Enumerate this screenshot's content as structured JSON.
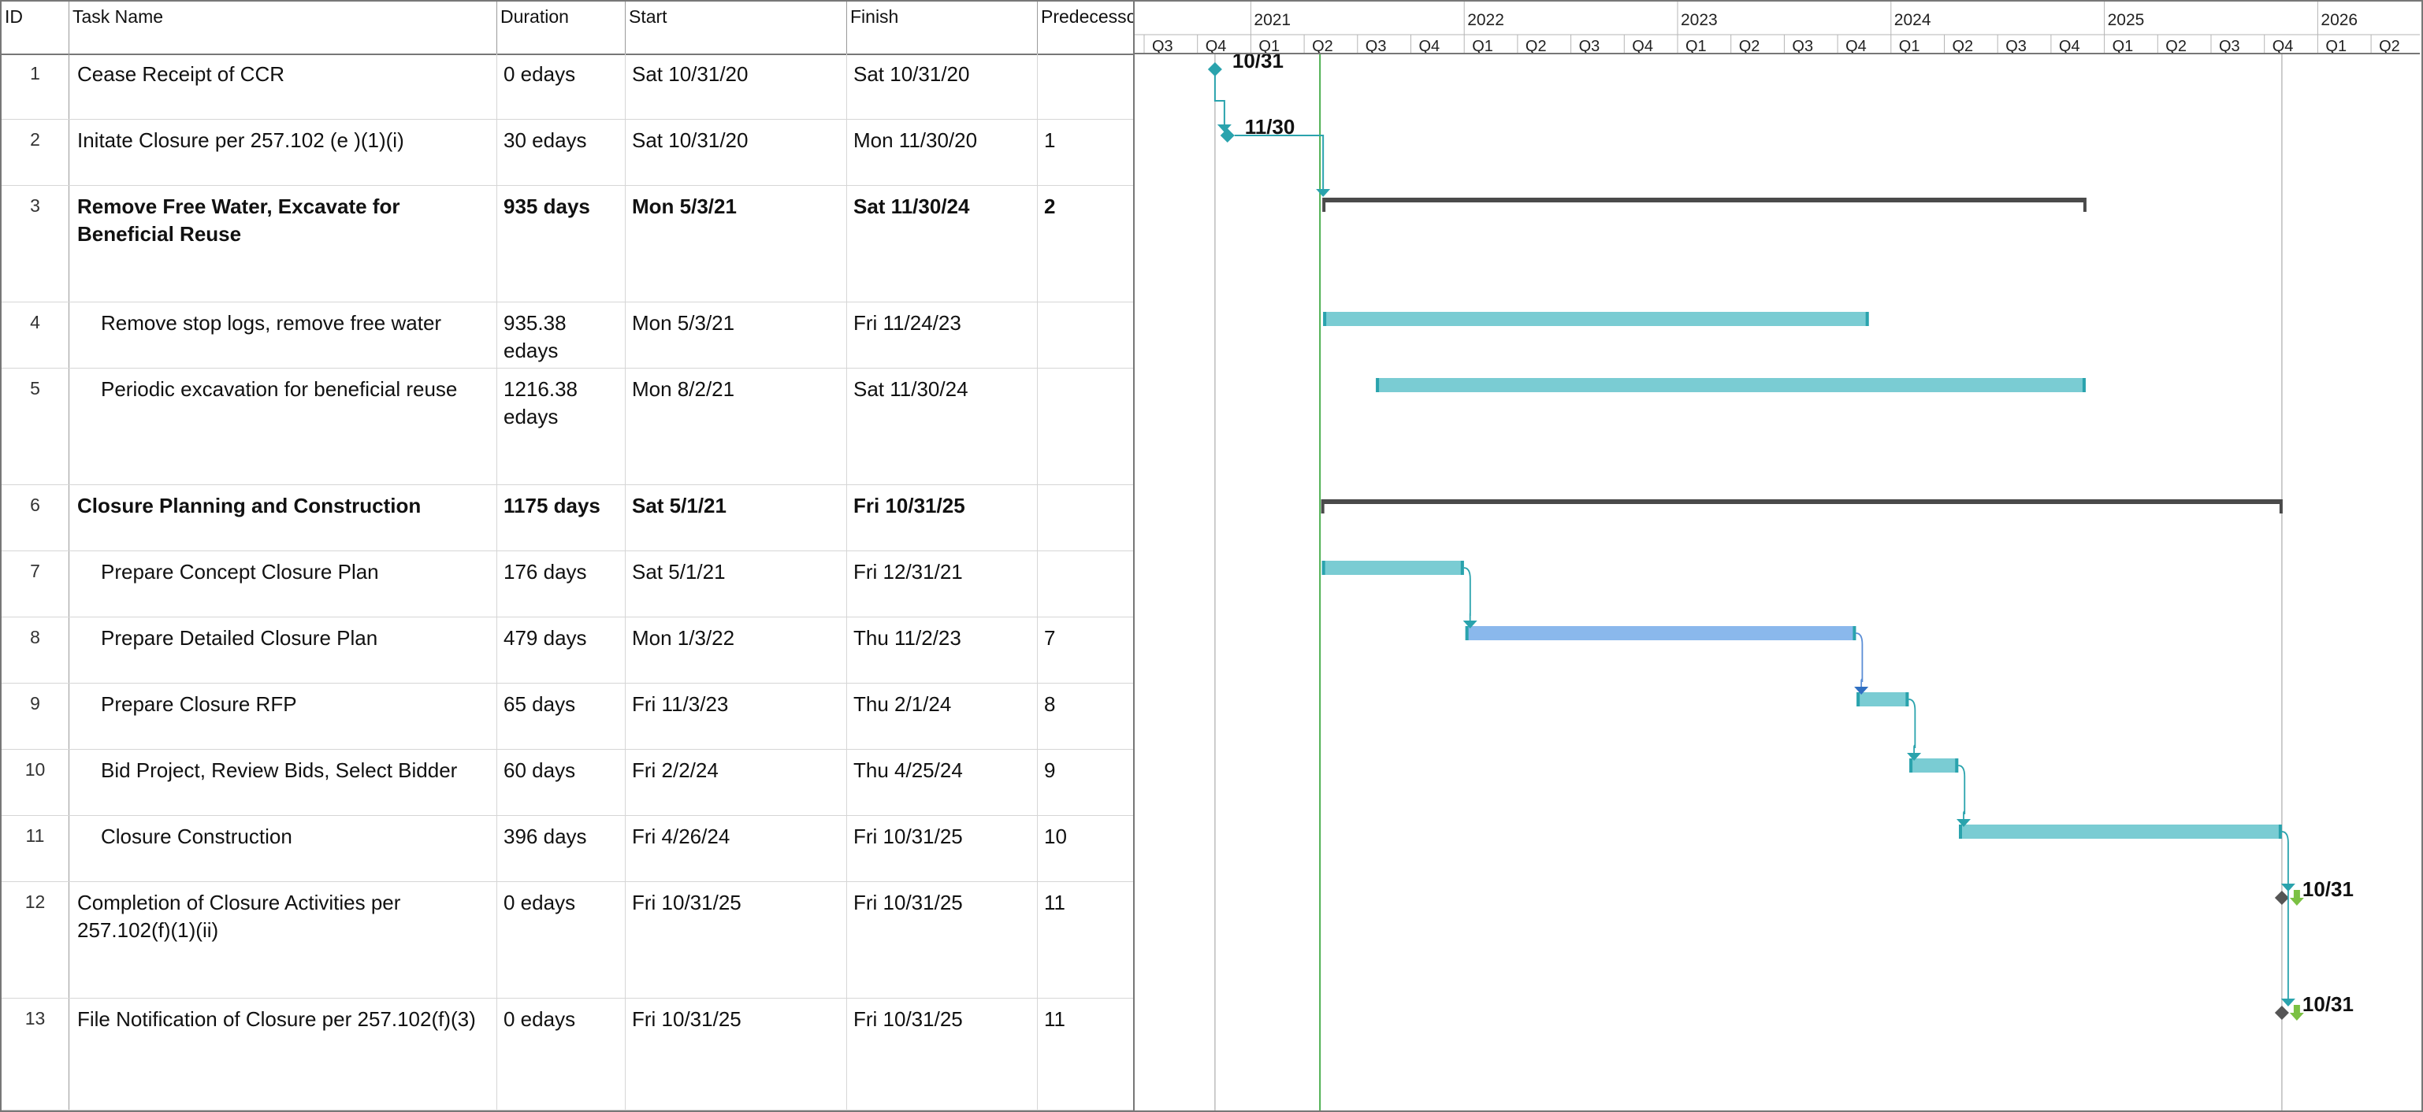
{
  "columns": {
    "id": "ID",
    "task_name": "Task Name",
    "duration": "Duration",
    "start": "Start",
    "finish": "Finish",
    "predecessors": "Predecesso"
  },
  "tasks": [
    {
      "id": "1",
      "name": "Cease Receipt of CCR",
      "duration": "0 edays",
      "start": "Sat 10/31/20",
      "finish": "Sat 10/31/20",
      "pred": "",
      "kind": "milestone",
      "label": "10/31"
    },
    {
      "id": "2",
      "name": "Initate Closure per 257.102 (e )(1)(i)",
      "duration": "30 edays",
      "start": "Sat 10/31/20",
      "finish": "Mon 11/30/20",
      "pred": "1",
      "kind": "milestone",
      "label": "11/30"
    },
    {
      "id": "3",
      "name": "Remove Free Water, Excavate for Beneficial Reuse",
      "duration": "935 days",
      "start": "Mon 5/3/21",
      "finish": "Sat 11/30/24",
      "pred": "2",
      "kind": "summary"
    },
    {
      "id": "4",
      "name": "Remove stop logs, remove free water",
      "duration": "935.38 edays",
      "start": "Mon 5/3/21",
      "finish": "Fri 11/24/23",
      "pred": "",
      "kind": "task"
    },
    {
      "id": "5",
      "name": "Periodic excavation for beneficial reuse",
      "duration": "1216.38 edays",
      "start": "Mon 8/2/21",
      "finish": "Sat 11/30/24",
      "pred": "",
      "kind": "task"
    },
    {
      "id": "6",
      "name": "Closure Planning and Construction",
      "duration": "1175 days",
      "start": "Sat 5/1/21",
      "finish": "Fri 10/31/25",
      "pred": "",
      "kind": "summary"
    },
    {
      "id": "7",
      "name": "Prepare Concept Closure Plan",
      "duration": "176 days",
      "start": "Sat 5/1/21",
      "finish": "Fri 12/31/21",
      "pred": "",
      "kind": "task"
    },
    {
      "id": "8",
      "name": "Prepare Detailed Closure Plan",
      "duration": "479 days",
      "start": "Mon 1/3/22",
      "finish": "Thu 11/2/23",
      "pred": "7",
      "kind": "task",
      "highlight": true
    },
    {
      "id": "9",
      "name": "Prepare Closure RFP",
      "duration": "65 days",
      "start": "Fri 11/3/23",
      "finish": "Thu 2/1/24",
      "pred": "8",
      "kind": "task"
    },
    {
      "id": "10",
      "name": "Bid Project, Review Bids, Select Bidder",
      "duration": "60 days",
      "start": "Fri 2/2/24",
      "finish": "Thu 4/25/24",
      "pred": "9",
      "kind": "task"
    },
    {
      "id": "11",
      "name": "Closure Construction",
      "duration": "396 days",
      "start": "Fri 4/26/24",
      "finish": "Fri 10/31/25",
      "pred": "10",
      "kind": "task"
    },
    {
      "id": "12",
      "name": "Completion of Closure Activities per 257.102(f)(1)(ii)",
      "duration": "0 edays",
      "start": "Fri 10/31/25",
      "finish": "Fri 10/31/25",
      "pred": "11",
      "kind": "milestone",
      "label": "10/31"
    },
    {
      "id": "13",
      "name": "File Notification of Closure per 257.102(f)(3)",
      "duration": "0 edays",
      "start": "Fri 10/31/25",
      "finish": "Fri 10/31/25",
      "pred": "11",
      "kind": "milestone",
      "label": "10/31"
    }
  ],
  "timeline": {
    "years": [
      "2021",
      "2022",
      "2023",
      "2024",
      "2025",
      "2026"
    ],
    "quarters": [
      "Q3",
      "Q4",
      "Q1",
      "Q2",
      "Q3",
      "Q4",
      "Q1",
      "Q2",
      "Q3",
      "Q4",
      "Q1",
      "Q2",
      "Q3",
      "Q4",
      "Q1",
      "Q2",
      "Q3",
      "Q4",
      "Q1",
      "Q2",
      "Q3",
      "Q4",
      "Q1",
      "Q2"
    ],
    "first_quarter": "2020-Q3"
  },
  "colors": {
    "task_bar": "#7accd3",
    "task_bar_end": "#2aa3ad",
    "highlight_bar": "#8ab8ec",
    "summary_bar": "#4a4a4a",
    "milestone": "#2aa3ad",
    "milestone_dark": "#555555",
    "link": "#2aa3ad",
    "today_line": "#4caf50",
    "deadline_arrow": "#7bc143"
  }
}
